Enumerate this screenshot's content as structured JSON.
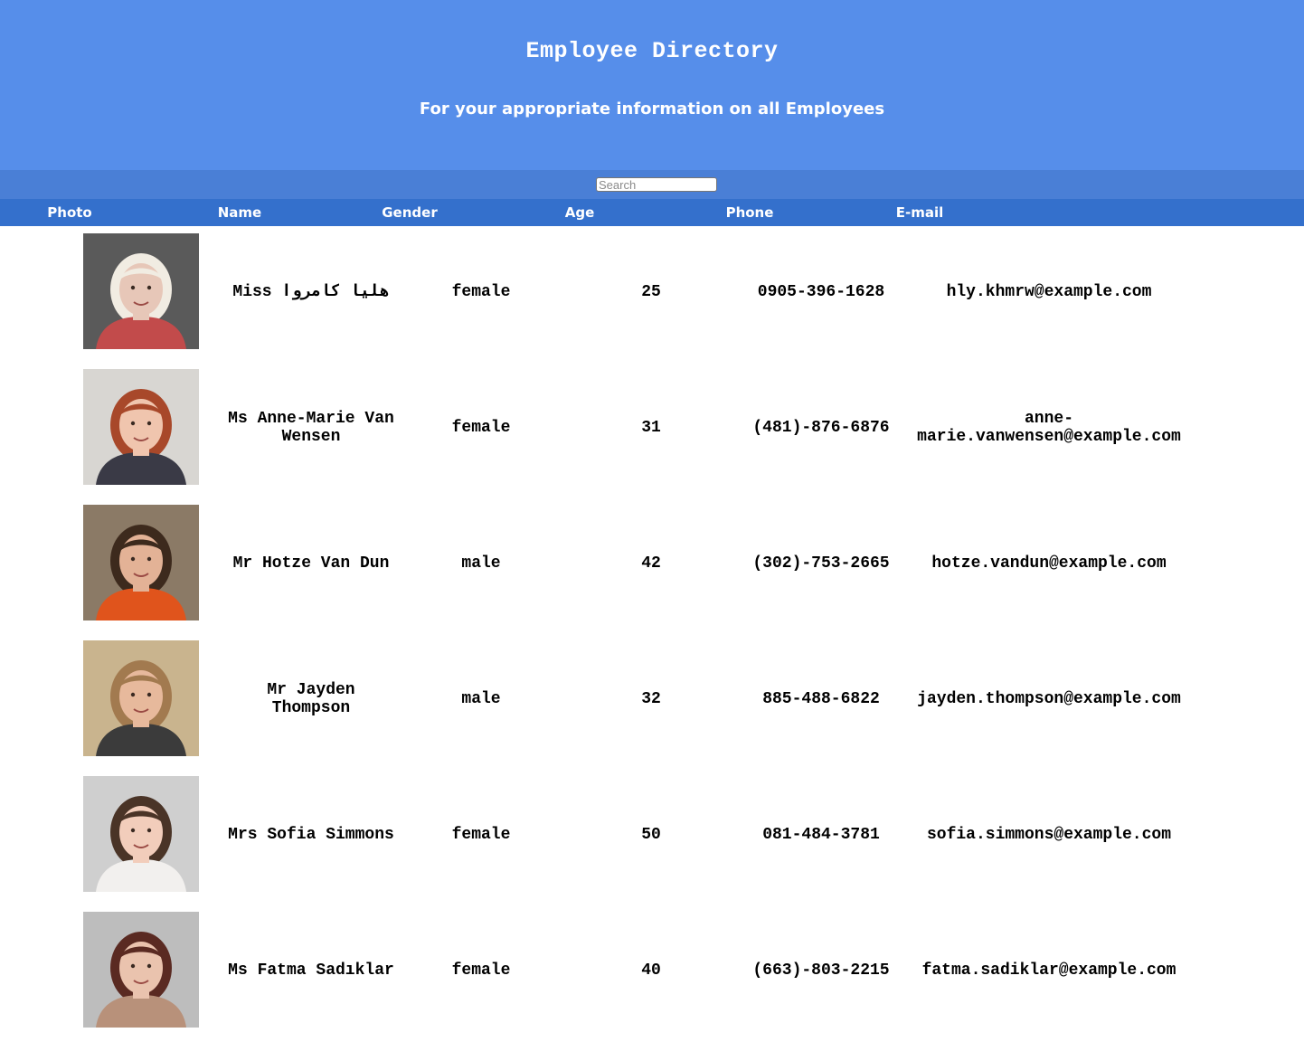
{
  "header": {
    "title": "Employee Directory",
    "subtitle": "For your appropriate information on all Employees"
  },
  "search": {
    "placeholder": "Search",
    "value": ""
  },
  "columns": [
    "Photo",
    "Name",
    "Gender",
    "Age",
    "Phone",
    "E-mail"
  ],
  "employees": [
    {
      "name": "Miss هلیا کامروا",
      "gender": "female",
      "age": "25",
      "phone": "0905-396-1628",
      "email": "hly.khmrw@example.com",
      "photo": {
        "bg": "#5a5a5a",
        "skin": "#e7c7b8",
        "hair": "#f1ece2",
        "shirt": "#c24b4b"
      }
    },
    {
      "name": "Ms Anne-Marie Van Wensen",
      "gender": "female",
      "age": "31",
      "phone": "(481)-876-6876",
      "email": "anne-marie.vanwensen@example.com",
      "photo": {
        "bg": "#d8d6d2",
        "skin": "#f0c5ae",
        "hair": "#a8482a",
        "shirt": "#3a3a46"
      }
    },
    {
      "name": "Mr Hotze Van Dun",
      "gender": "male",
      "age": "42",
      "phone": "(302)-753-2665",
      "email": "hotze.vandun@example.com",
      "photo": {
        "bg": "#8b7a66",
        "skin": "#e3b296",
        "hair": "#3d2a1d",
        "shirt": "#e0541c"
      }
    },
    {
      "name": "Mr Jayden Thompson",
      "gender": "male",
      "age": "32",
      "phone": "885-488-6822",
      "email": "jayden.thompson@example.com",
      "photo": {
        "bg": "#c9b48e",
        "skin": "#e7b99c",
        "hair": "#a27a4f",
        "shirt": "#3b3b3b"
      }
    },
    {
      "name": "Mrs Sofia Simmons",
      "gender": "female",
      "age": "50",
      "phone": "081-484-3781",
      "email": "sofia.simmons@example.com",
      "photo": {
        "bg": "#cfcfcf",
        "skin": "#f2cdbb",
        "hair": "#4a3427",
        "shirt": "#f2f0ee"
      }
    },
    {
      "name": "Ms Fatma Sadıklar",
      "gender": "female",
      "age": "40",
      "phone": "(663)-803-2215",
      "email": "fatma.sadiklar@example.com",
      "photo": {
        "bg": "#bdbdbd",
        "skin": "#eac3ae",
        "hair": "#5a2a22",
        "shirt": "#b8917a"
      }
    }
  ]
}
